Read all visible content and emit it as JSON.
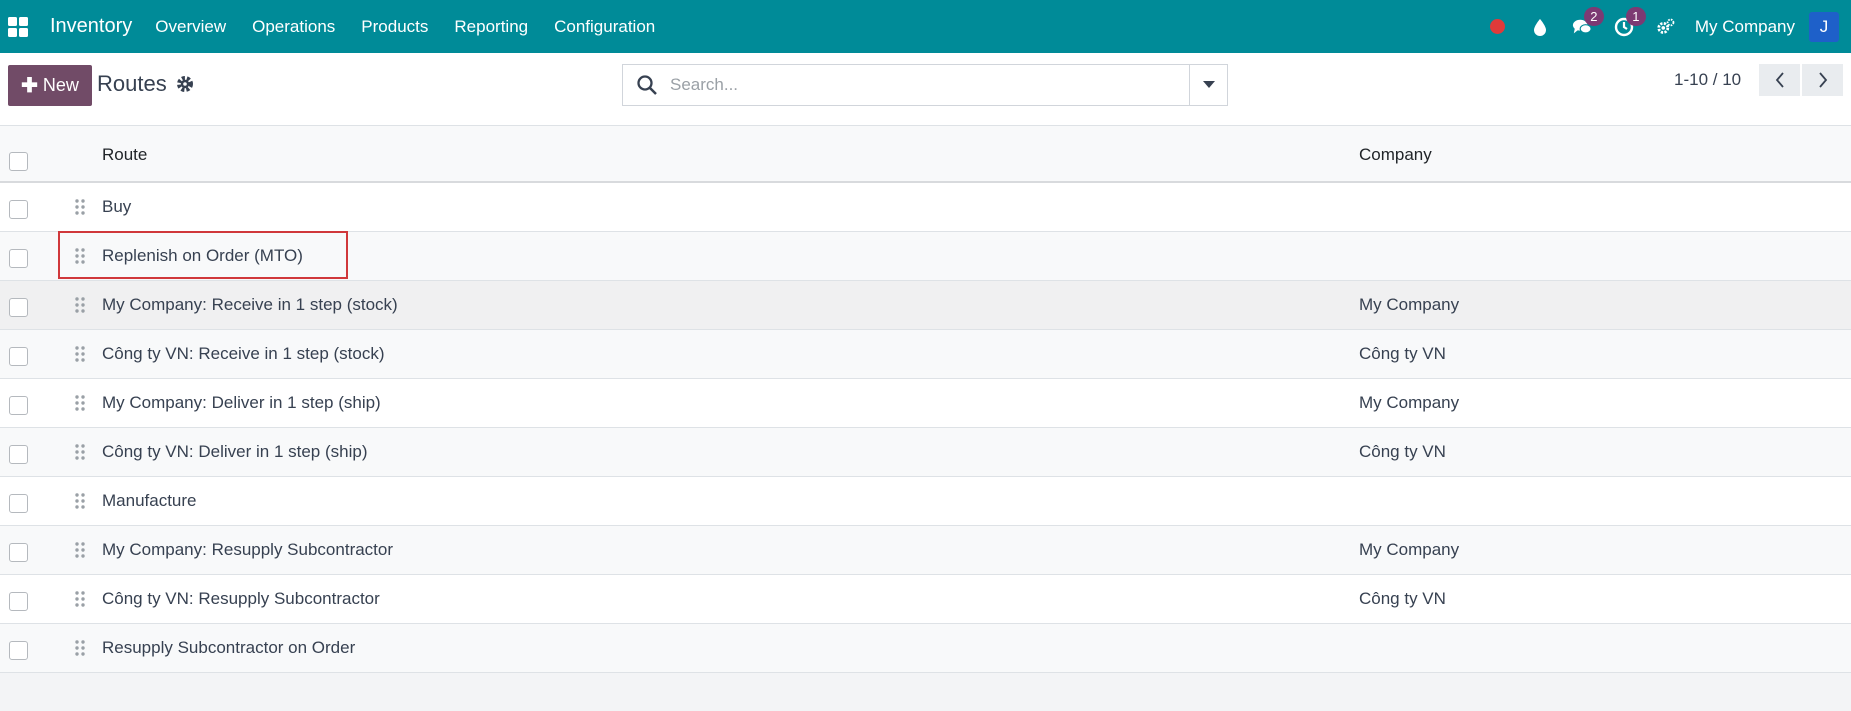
{
  "navbar": {
    "app_name": "Inventory",
    "menu": [
      "Overview",
      "Operations",
      "Products",
      "Reporting",
      "Configuration"
    ],
    "messages_count": "2",
    "activities_count": "1",
    "company": "My Company",
    "avatar_letter": "J",
    "accent_color": "#008b98"
  },
  "control": {
    "new_label": "New",
    "title": "Routes",
    "search_placeholder": "Search...",
    "pager": "1-10 / 10"
  },
  "list": {
    "headers": {
      "route": "Route",
      "company": "Company"
    },
    "rows": [
      {
        "route": "Buy",
        "company": ""
      },
      {
        "route": "Replenish on Order (MTO)",
        "company": ""
      },
      {
        "route": "My Company: Receive in 1 step (stock)",
        "company": "My Company"
      },
      {
        "route": "Công ty VN: Receive in 1 step (stock)",
        "company": "Công ty VN"
      },
      {
        "route": "My Company: Deliver in 1 step (ship)",
        "company": "My Company"
      },
      {
        "route": "Công ty VN: Deliver in 1 step (ship)",
        "company": "Công ty VN"
      },
      {
        "route": "Manufacture",
        "company": ""
      },
      {
        "route": "My Company: Resupply Subcontractor",
        "company": "My Company"
      },
      {
        "route": "Công ty VN: Resupply Subcontractor",
        "company": "Công ty VN"
      },
      {
        "route": "Resupply Subcontractor on Order",
        "company": ""
      }
    ]
  }
}
